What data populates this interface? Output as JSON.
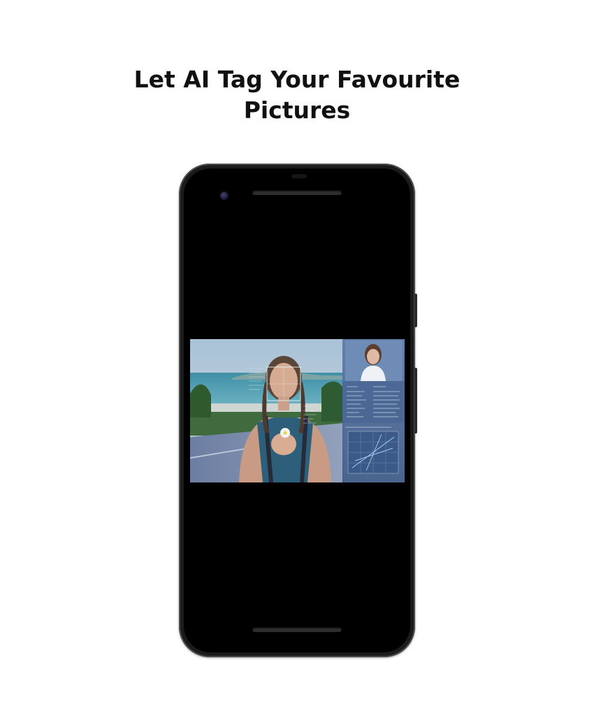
{
  "headline": {
    "line1": "Let AI Tag Your Favourite",
    "line2": "Pictures"
  },
  "image": {
    "description_icon": "ai-face-recognition-photo-icon"
  },
  "colors": {
    "background": "#ffffff",
    "headline": "#111111",
    "phone_body": "#1b1b1b",
    "screen": "#000000"
  }
}
